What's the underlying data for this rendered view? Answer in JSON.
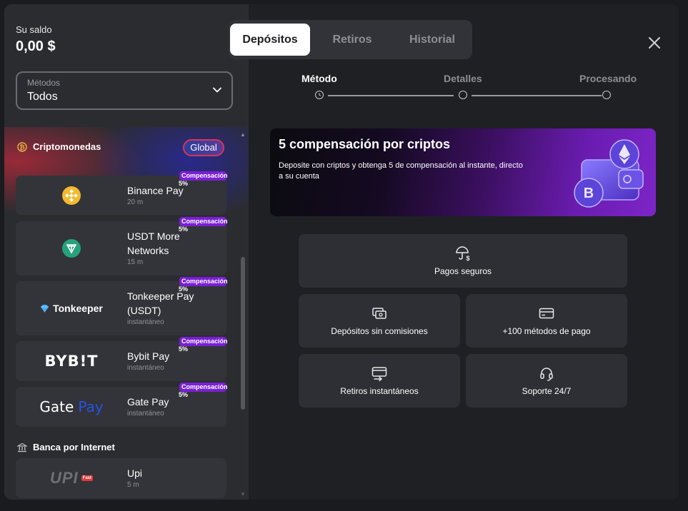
{
  "balance": {
    "label": "Su saldo",
    "value": "0,00 $"
  },
  "methods_select": {
    "label": "Métodos",
    "value": "Todos"
  },
  "tabs": [
    {
      "label": "Depósitos",
      "active": true
    },
    {
      "label": "Retiros",
      "active": false
    },
    {
      "label": "Historial",
      "active": false
    }
  ],
  "steps": [
    {
      "label": "Método",
      "active": true
    },
    {
      "label": "Detalles",
      "active": false
    },
    {
      "label": "Procesando",
      "active": false
    }
  ],
  "crypto_section": {
    "title": "Criptomonedas",
    "badge": "Global",
    "promo_label": "Compensación",
    "promo_pct": "5%",
    "items": [
      {
        "name": "Binance Pay",
        "time": "20 m",
        "logo": "binance-logo"
      },
      {
        "name_line1": "USDT More",
        "name_line2": "Networks",
        "time": "15 m",
        "logo": "usdt-logo"
      },
      {
        "logo_text": "Tonkeeper",
        "name_line1": "Tonkeeper Pay",
        "name_line2": "(USDT)",
        "time": "instantáneo",
        "logo": "tonkeeper-logo"
      },
      {
        "logo_text": "BYB!T",
        "name": "Bybit Pay",
        "time": "instantáneo",
        "logo": "bybit-logo"
      },
      {
        "logo_text_a": "Gate",
        "logo_text_b": "Pay",
        "name": "Gate Pay",
        "time": "instantáneo",
        "logo": "gatepay-logo"
      }
    ]
  },
  "bank_section": {
    "title": "Banca por Internet",
    "items": [
      {
        "logo_text": "UPI",
        "logo_badge": "Fast",
        "name": "Upi",
        "time": "5 m",
        "logo": "upi-logo"
      }
    ]
  },
  "banner": {
    "title": "5 compensación por criptos",
    "text": "Deposite con criptos y obtenga 5 de compensación al instante, directo a su cuenta"
  },
  "features": [
    {
      "label": "Pagos seguros",
      "icon": "umbrella-dollar-icon"
    },
    {
      "label": "Depósitos sin comisiones",
      "icon": "cash-icon"
    },
    {
      "label": "+100 métodos de pago",
      "icon": "card-icon"
    },
    {
      "label": "Retiros instantáneos",
      "icon": "withdraw-icon"
    },
    {
      "label": "Soporte 24/7",
      "icon": "headset-icon"
    }
  ],
  "colors": {
    "accent_purple": "#7a1fd6",
    "badge_border": "#d9364f",
    "binance": "#f3ba2f",
    "usdt": "#26a17b",
    "gate_blue": "#2354e6"
  }
}
